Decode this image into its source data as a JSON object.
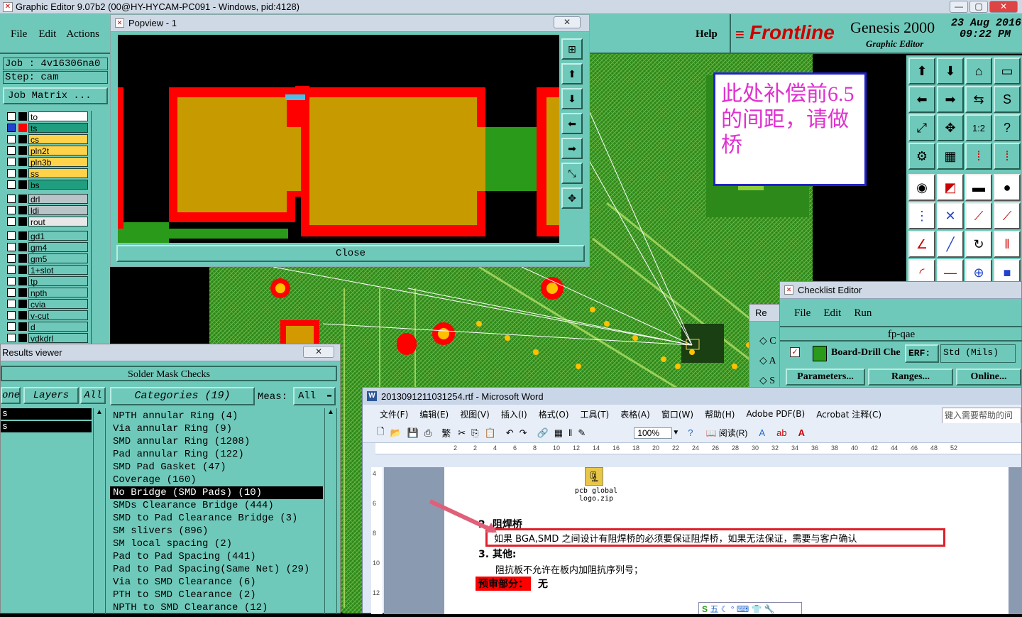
{
  "app_title": "Graphic Editor 9.07b2 (00@HY-HYCAM-PC091 - Windows, pid:4128)",
  "main_menu": [
    "File",
    "Edit",
    "Actions"
  ],
  "help_label": "Help",
  "brand": {
    "logo": "Frontline",
    "product": "Genesis 2000",
    "subtitle": "Graphic Editor",
    "date": "23 Aug 2016",
    "time": "09:22 PM"
  },
  "job": {
    "job_label": "Job : 4v16306na0",
    "step_label": "Step: cam",
    "matrix_button": "Job Matrix ..."
  },
  "layers": [
    {
      "name": "to",
      "color": "#ffffff"
    },
    {
      "name": "ts",
      "color": "#1f9f7f"
    },
    {
      "name": "cs",
      "color": "#ffd24a"
    },
    {
      "name": "pln2t",
      "color": "#ffd24a"
    },
    {
      "name": "pln3b",
      "color": "#ffd24a"
    },
    {
      "name": "ss",
      "color": "#ffd24a"
    },
    {
      "name": "bs",
      "color": "#1f9f7f"
    },
    {
      "name": "drl",
      "color": "#b8c4c8"
    },
    {
      "name": "ldi",
      "color": "#b8c4c8"
    },
    {
      "name": "rout",
      "color": "#e8e8e8"
    },
    {
      "name": "gd1",
      "color": "#6fc9ba"
    },
    {
      "name": "gm4",
      "color": "#6fc9ba"
    },
    {
      "name": "gm5",
      "color": "#6fc9ba"
    },
    {
      "name": "1+slot",
      "color": "#6fc9ba"
    },
    {
      "name": "tp",
      "color": "#6fc9ba"
    },
    {
      "name": "npth",
      "color": "#6fc9ba"
    },
    {
      "name": "cvia",
      "color": "#6fc9ba"
    },
    {
      "name": "v-cut",
      "color": "#6fc9ba"
    },
    {
      "name": "d",
      "color": "#6fc9ba"
    },
    {
      "name": "vdkdrl",
      "color": "#6fc9ba"
    }
  ],
  "popview": {
    "title": "Popview - 1",
    "close_label": "Close",
    "close_x": "✕"
  },
  "annotation_text": "此处补偿前6.5的间距，请做桥",
  "results": {
    "title": "Results viewer",
    "close_x": "✕",
    "header": "Solder Mask Checks",
    "tab_left": "one",
    "tab_layers": "Layers",
    "tab_all": "All",
    "categories_label": "Categories (19)",
    "meas_label": "Meas:",
    "meas_value": "All",
    "left_items": [
      "s",
      "s"
    ],
    "categories": [
      "NPTH annular Ring (4)",
      "Via annular Ring (9)",
      "SMD annular Ring (1208)",
      "Pad annular Ring (122)",
      "SMD Pad Gasket (47)",
      "Coverage (160)",
      "No Bridge (SMD Pads) (10)",
      "SMDs Clearance Bridge (444)",
      "SMD to Pad Clearance Bridge (3)",
      "SM slivers (896)",
      "SM local spacing (2)",
      "Pad to Pad Spacing (441)",
      "Pad to Pad Spacing(Same Net) (29)",
      "Via to SMD Clearance (6)",
      "PTH to SMD Clearance (2)",
      "NPTH to SMD Clearance (12)"
    ],
    "selected_index": 6
  },
  "checklist": {
    "title": "Checklist Editor",
    "menu": [
      "File",
      "Edit",
      "Run"
    ],
    "name": "fp-qae",
    "row_label": "Board-Drill Che",
    "erf_label": "ERF:",
    "erf_value": "Std (Mils)",
    "buttons": [
      "Parameters...",
      "Ranges...",
      "Online..."
    ]
  },
  "re_window": {
    "title": "Re",
    "items": [
      "C",
      "A",
      "S"
    ]
  },
  "word": {
    "title": "2013091211031254.rtf - Microsoft Word",
    "menu": [
      "文件(F)",
      "编辑(E)",
      "视图(V)",
      "插入(I)",
      "格式(O)",
      "工具(T)",
      "表格(A)",
      "窗口(W)",
      "帮助(H)",
      "Adobe PDF(B)",
      "Acrobat 注释(C)"
    ],
    "help_box": "键入需要帮助的问题",
    "zoom": "100%",
    "reading": "阅读(R)",
    "ruler_marks": [
      "2",
      "2",
      "4",
      "6",
      "8",
      "10",
      "12",
      "14",
      "16",
      "18",
      "20",
      "22",
      "24",
      "26",
      "28",
      "30",
      "32",
      "34",
      "36",
      "38",
      "40",
      "42",
      "44",
      "46",
      "48",
      "52"
    ],
    "vruler_marks": [
      "4",
      "6",
      "8",
      "10",
      "12"
    ],
    "attachment": "pcb global logo.zip",
    "heading2": "2. 阻焊桥",
    "para2": "如果 BGA,SMD 之间设计有阻焊桥的必须要保证阻焊桥，如果无法保证，需要与客户确认",
    "heading3": "3. 其他:",
    "para3": "阻抗板不允许在板内加阻抗序列号；",
    "review_label": "预审部分：",
    "review_value": "无",
    "ime": "五"
  },
  "colors": {
    "teal": "#6fc9ba",
    "pcb_green": "#2d8a1a",
    "pad_orange": "#c79a00",
    "mask_red": "#ff0000",
    "annotation_magenta": "#e030d0"
  }
}
